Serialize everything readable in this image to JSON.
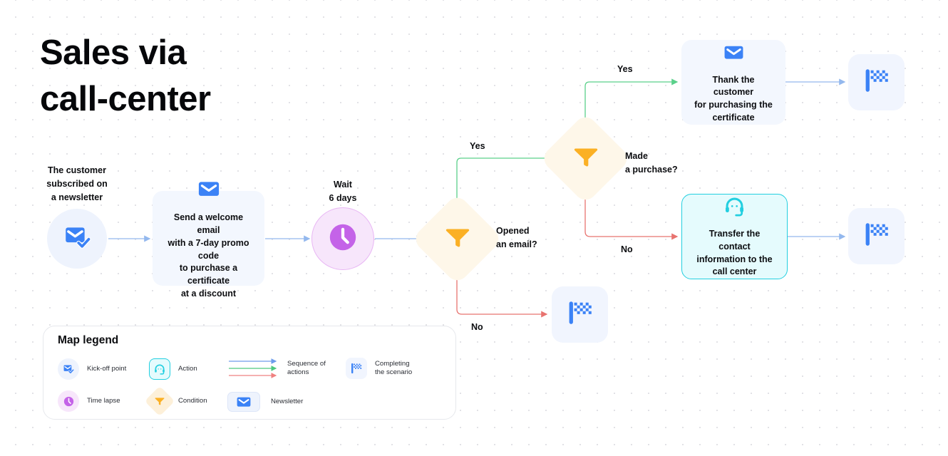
{
  "title": "Sales via\ncall-center",
  "colors": {
    "blue": "#3b82f6",
    "blue_light_bg": "#f1f5fe",
    "green": "#4ade80",
    "green_stroke": "#5ad08a",
    "red_stroke": "#e8736f",
    "blue_stroke": "#93b8ee",
    "orange": "#fbb024",
    "diamond_bg": "#fef7e9",
    "purple": "#c463e8",
    "purple_bg": "#f7e6fb",
    "purple_border": "#e8b6f4",
    "cyan": "#22cfe0",
    "cyan_bg": "#e5fbfd",
    "dot_grid": "#e2e2e6",
    "text": "#0c0d10"
  },
  "nodes": {
    "start": {
      "caption": "The customer\nsubscribed on\na newsletter",
      "icon": "envelope-check-icon"
    },
    "welcome_email": {
      "label": "Send a welcome email\nwith a 7-day promo code\nto purchase a certificate\nat a discount",
      "icon": "envelope-icon"
    },
    "wait": {
      "caption": "Wait\n6 days",
      "icon": "clock-icon"
    },
    "cond_opened": {
      "caption": "Opened\nan email?",
      "icon": "funnel-icon"
    },
    "cond_purchase": {
      "caption": "Made\na purchase?",
      "icon": "funnel-icon"
    },
    "thank_customer": {
      "label": "Thank the customer\nfor purchasing the\ncertificate",
      "icon": "envelope-icon"
    },
    "transfer_contact": {
      "label": "Transfer the contact\ninformation to the\ncall center",
      "icon": "headset-icon"
    },
    "finish_top": {
      "icon": "checkered-flag-icon"
    },
    "finish_mid": {
      "icon": "checkered-flag-icon"
    },
    "finish_bottom": {
      "icon": "checkered-flag-icon"
    }
  },
  "edge_labels": {
    "opened_yes": "Yes",
    "opened_no": "No",
    "purchase_yes": "Yes",
    "purchase_no": "No"
  },
  "legend": {
    "title": "Map legend",
    "items": [
      {
        "key": "kickoff",
        "label": "Kick-off point",
        "icon": "envelope-check-icon"
      },
      {
        "key": "timelapse",
        "label": "Time lapse",
        "icon": "clock-icon"
      },
      {
        "key": "action",
        "label": "Action",
        "icon": "headset-icon"
      },
      {
        "key": "condition",
        "label": "Condition",
        "icon": "funnel-icon"
      },
      {
        "key": "sequence",
        "label": "Sequence of\nactions",
        "icon": "arrows-icon"
      },
      {
        "key": "newsletter",
        "label": "Newsletter",
        "icon": "envelope-icon"
      },
      {
        "key": "completing",
        "label": "Completing\nthe scenario",
        "icon": "checkered-flag-icon"
      }
    ]
  }
}
